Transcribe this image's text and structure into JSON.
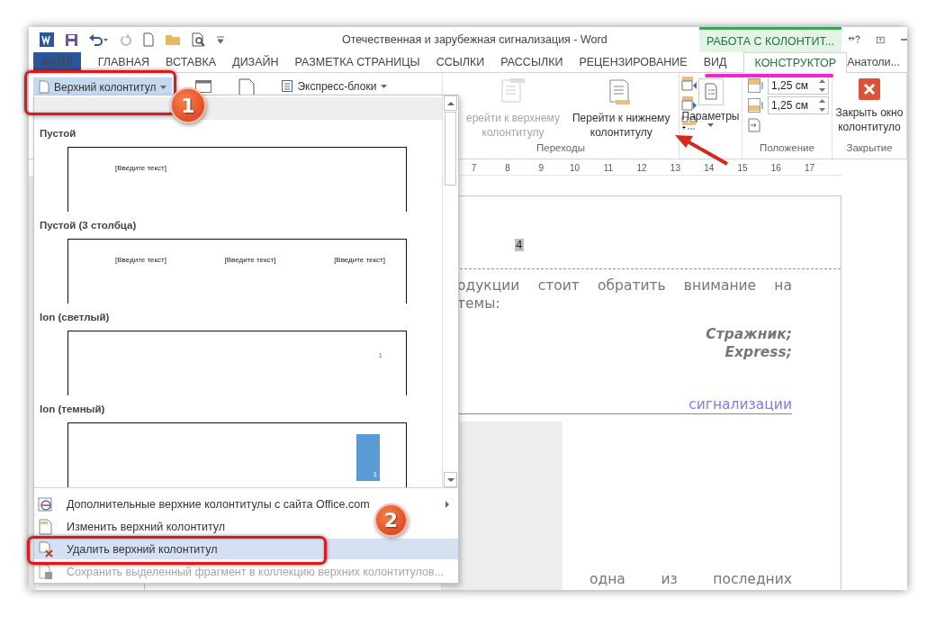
{
  "window": {
    "title": "Отечественная и зарубежная сигнализация - Word",
    "context_tab": "РАБОТА С КОЛОНТИТ...",
    "user": "Анатоли..."
  },
  "tabs": [
    {
      "label": "ФАЙЛ",
      "kind": "file",
      "selected": false
    },
    {
      "label": "ГЛАВНАЯ",
      "kind": "plain",
      "selected": false
    },
    {
      "label": "ВСТАВКА",
      "kind": "plain",
      "selected": false
    },
    {
      "label": "ДИЗАЙН",
      "kind": "plain",
      "selected": false
    },
    {
      "label": "РАЗМЕТКА СТРАНИЦЫ",
      "kind": "plain",
      "selected": false
    },
    {
      "label": "ССЫЛКИ",
      "kind": "plain",
      "selected": false
    },
    {
      "label": "РАССЫЛКИ",
      "kind": "plain",
      "selected": false
    },
    {
      "label": "РЕЦЕНЗИРОВАНИЕ",
      "kind": "plain",
      "selected": false
    },
    {
      "label": "ВИД",
      "kind": "plain",
      "selected": false
    },
    {
      "label": "КОНСТРУКТОР",
      "kind": "context",
      "selected": true
    }
  ],
  "ribbon": {
    "header_button": {
      "label": "Верхний колонтитул",
      "selected": true
    },
    "quick_parts": "Экспресс-блоки",
    "navigation": {
      "label": "Переходы",
      "buttons": [
        {
          "lines": [
            "ерейти к верхнему",
            "колонтитулу"
          ],
          "disabled": true
        },
        {
          "lines": [
            "Перейти к нижнему",
            "колонтитулу"
          ],
          "disabled": false
        }
      ]
    },
    "options": {
      "label": "Параметры"
    },
    "position": {
      "label": "Положение",
      "fields": [
        "1,25 см",
        "1,25 см"
      ]
    },
    "close": {
      "label": "Закрытие",
      "lines": [
        "Закрыть окно",
        "колонтитуло"
      ]
    }
  },
  "ruler": [
    "7",
    "8",
    "9",
    "10",
    "11",
    "12",
    "13",
    "14",
    "15",
    "16",
    "17"
  ],
  "document": {
    "page_number": "4",
    "paragraph": [
      "одукции стоит обратить внимание на",
      "темы:"
    ],
    "list": [
      "Стражник;",
      "Express;"
    ],
    "link": "сигнализации",
    "last_line": "одна из последних"
  },
  "dropdown": {
    "gallery": [
      {
        "title": "Пустой",
        "kind": "blank",
        "placeholders": [
          "[Введите текст]"
        ]
      },
      {
        "title": "Пустой (3 столбца)",
        "kind": "three",
        "placeholders": [
          "[Введите текст]",
          "[Введите текст]",
          "[Введите текст]"
        ]
      },
      {
        "title": "Ion (светлый)",
        "kind": "ion-light",
        "page": "1"
      },
      {
        "title": "Ion (темный)",
        "kind": "ion-dark",
        "page": "1"
      }
    ],
    "commands": [
      {
        "label": "Дополнительные верхние колонтитулы с сайта Office.com",
        "kind": "online",
        "submenu": true,
        "selected": false,
        "disabled": false
      },
      {
        "label": "Изменить верхний колонтитул",
        "kind": "edit",
        "submenu": false,
        "selected": false,
        "disabled": false
      },
      {
        "label": "Удалить верхний колонтитул",
        "kind": "remove",
        "submenu": false,
        "selected": true,
        "disabled": false
      },
      {
        "label": "Сохранить выделенный фрагмент в коллекцию верхних колонтитулов...",
        "kind": "save",
        "submenu": false,
        "selected": false,
        "disabled": true
      }
    ]
  },
  "annotations": {
    "steps": [
      "1",
      "2"
    ]
  }
}
